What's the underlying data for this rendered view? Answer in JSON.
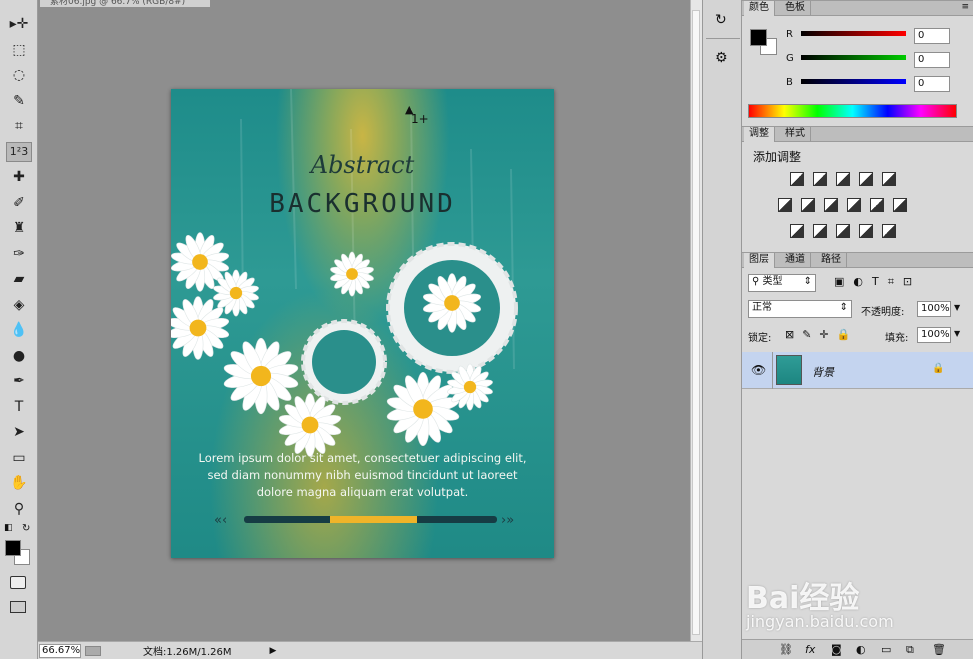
{
  "document": {
    "tab_title": "素材06.jpg @ 66.7% (RGB/8#)"
  },
  "tools": [
    {
      "name": "move-tool-icon",
      "glyph": "▸✛"
    },
    {
      "name": "marquee-tool-icon",
      "glyph": "⬚"
    },
    {
      "name": "lasso-tool-icon",
      "glyph": "◌"
    },
    {
      "name": "quick-select-tool-icon",
      "glyph": "✎"
    },
    {
      "name": "crop-tool-icon",
      "glyph": "⌗"
    },
    {
      "name": "count-tool-icon",
      "glyph": "1²3"
    },
    {
      "name": "healing-tool-icon",
      "glyph": "✚"
    },
    {
      "name": "brush-tool-icon",
      "glyph": "✐"
    },
    {
      "name": "stamp-tool-icon",
      "glyph": "♜"
    },
    {
      "name": "history-brush-tool-icon",
      "glyph": "✑"
    },
    {
      "name": "eraser-tool-icon",
      "glyph": "▰"
    },
    {
      "name": "paint-bucket-tool-icon",
      "glyph": "◈"
    },
    {
      "name": "blur-tool-icon",
      "glyph": "💧"
    },
    {
      "name": "dodge-tool-icon",
      "glyph": "●"
    },
    {
      "name": "pen-tool-icon",
      "glyph": "✒"
    },
    {
      "name": "type-tool-icon",
      "glyph": "T"
    },
    {
      "name": "path-select-tool-icon",
      "glyph": "➤"
    },
    {
      "name": "rectangle-tool-icon",
      "glyph": "▭"
    },
    {
      "name": "hand-tool-icon",
      "glyph": "✋"
    },
    {
      "name": "zoom-tool-icon",
      "glyph": "⚲"
    }
  ],
  "colors": {
    "foreground": "#000000",
    "background": "#ffffff",
    "accent": "#c4d4ef",
    "poster_teal": "#1e8c8a",
    "progress": "#f0b429"
  },
  "poster": {
    "script": "Abstract",
    "title": "BACKGROUND",
    "body": "Lorem ipsum dolor sit amet, consectetuer adipiscing elit, sed diam nonummy nibh euismod tincidunt ut laoreet dolore magna aliquam erat volutpat."
  },
  "cursor_label": "1+",
  "status": {
    "zoom": "66.67%",
    "doc_info": "文档:1.26M/1.26M"
  },
  "color_panel": {
    "tabs": [
      "颜色",
      "色板"
    ],
    "r_label": "R",
    "g_label": "G",
    "b_label": "B",
    "r": "0",
    "g": "0",
    "b": "0"
  },
  "adjust_panel": {
    "tabs": [
      "调整",
      "样式"
    ],
    "heading": "添加调整"
  },
  "layers_panel": {
    "tabs": [
      "图层",
      "通道",
      "路径"
    ],
    "filter": "类型",
    "blend": "正常",
    "opacity_label": "不透明度:",
    "opacity": "100%",
    "lock_label": "锁定:",
    "fill_label": "填充:",
    "fill": "100%",
    "layer_name": "背景"
  },
  "watermark": {
    "brand": "Bai经验",
    "url": "jingyan.baidu.com"
  }
}
